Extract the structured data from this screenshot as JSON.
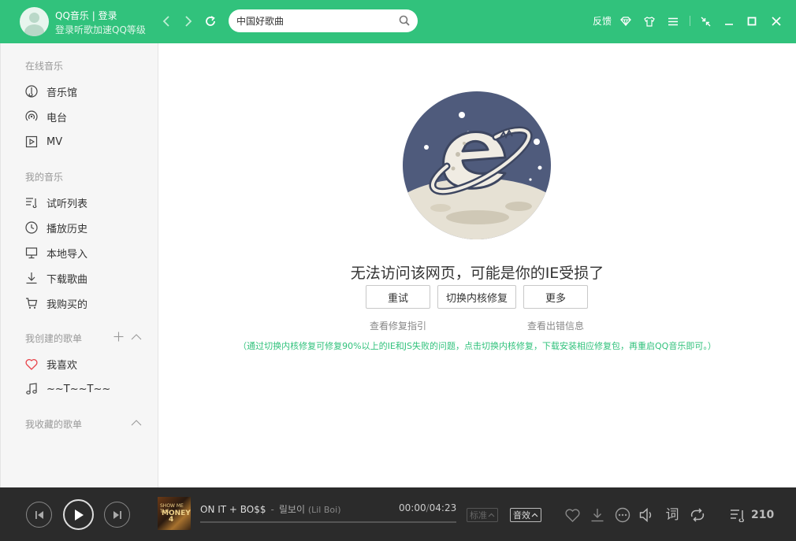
{
  "header": {
    "user_name": "QQ音乐 | 登录",
    "user_sub": "登录听歌加速QQ等级",
    "search_value": "中国好歌曲",
    "feedback_label": "反馈",
    "icons": [
      "back-icon",
      "forward-icon",
      "refresh-icon",
      "search-icon",
      "diamond-icon",
      "skin-icon",
      "menu-icon",
      "mini-mode-icon",
      "minimize-icon",
      "maximize-icon",
      "close-icon"
    ]
  },
  "sidebar": {
    "online_title": "在线音乐",
    "online_items": [
      {
        "label": "音乐馆",
        "icon": "music-hall-icon"
      },
      {
        "label": "电台",
        "icon": "radio-icon"
      },
      {
        "label": "MV",
        "icon": "mv-icon"
      }
    ],
    "my_title": "我的音乐",
    "my_items": [
      {
        "label": "试听列表",
        "icon": "playlist-icon"
      },
      {
        "label": "播放历史",
        "icon": "history-icon"
      },
      {
        "label": "本地导入",
        "icon": "local-import-icon"
      },
      {
        "label": "下载歌曲",
        "icon": "download-icon"
      },
      {
        "label": "我购买的",
        "icon": "cart-icon"
      }
    ],
    "created_title": "我创建的歌单",
    "created_items": [
      {
        "label": "我喜欢",
        "icon": "heart-icon"
      },
      {
        "label": "~~T~~T~~",
        "icon": "note-icon"
      }
    ],
    "collected_title": "我收藏的歌单"
  },
  "main": {
    "error_title": "无法访问该网页，可能是你的IE受损了",
    "buttons": {
      "retry": "重试",
      "switch_kernel": "切换内核修复",
      "more": "更多"
    },
    "links": {
      "repair_guide": "查看修复指引",
      "error_info": "查看出错信息"
    },
    "hint": "（通过切换内核修复可修复90%以上的IE和JS失败的问题，点击切换内核修复，下载安装相应修复包，再重启QQ音乐即可。）"
  },
  "player": {
    "song_title": "ON IT + BO$$",
    "separator": "-",
    "artist": "릴보이",
    "artist_en": "(Lil Boi)",
    "cover_text_1": "SHOW ME THE",
    "cover_text_2": "MONEY",
    "cover_text_3": "4",
    "time_current": "00:00",
    "time_total": "04:23",
    "progress": 0,
    "quality_label": "标准",
    "effect_label": "音效",
    "playlist_count": "210"
  },
  "colors": {
    "accent": "#31c27c",
    "player_bg": "#2b2b2b"
  }
}
